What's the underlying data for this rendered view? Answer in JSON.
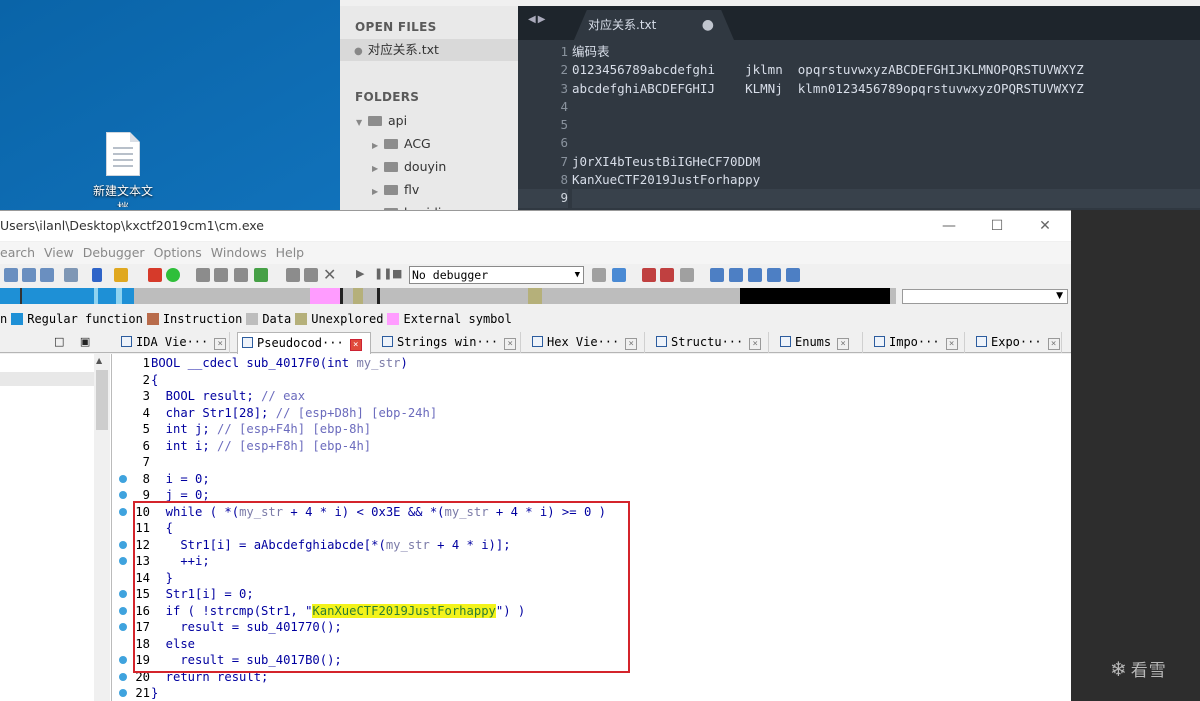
{
  "desktop": {
    "icon_label": "新建文本文",
    "icon_label_line2": "档"
  },
  "sublime": {
    "open_files_header": "OPEN FILES",
    "open_file": "对应关系.txt",
    "folders_header": "FOLDERS",
    "folders": [
      {
        "name": "api",
        "expanded": true,
        "level": 0
      },
      {
        "name": "ACG",
        "expanded": false,
        "level": 1
      },
      {
        "name": "douyin",
        "expanded": false,
        "level": 1
      },
      {
        "name": "flv",
        "expanded": false,
        "level": 1
      },
      {
        "name": "kuaidi",
        "expanded": false,
        "level": 1
      }
    ],
    "tab_title": "对应关系.txt",
    "tab_modified": "●",
    "lines": [
      {
        "n": "1",
        "text": "编码表"
      },
      {
        "n": "2",
        "text": "0123456789abcdefghi    jklmn  opqrstuvwxyzABCDEFGHIJKLMNOPQRSTUVWXYZ"
      },
      {
        "n": "3",
        "text": "abcdefghiABCDEFGHIJ    KLMNj  klmn0123456789opqrstuvwxyzOPQRSTUVWXYZ"
      },
      {
        "n": "4",
        "text": ""
      },
      {
        "n": "5",
        "text": ""
      },
      {
        "n": "6",
        "text": ""
      },
      {
        "n": "7",
        "text": "j0rXI4bTeustBiIGHeCF70DDM"
      },
      {
        "n": "8",
        "text": "KanXueCTF2019JustForhappy"
      },
      {
        "n": "9",
        "text": ""
      }
    ],
    "current_line": "9"
  },
  "ida": {
    "title": "Users\\ilanl\\Desktop\\kxctf2019cm1\\cm.exe",
    "window_controls": {
      "minimize": "—",
      "maximize": "☐",
      "close": "✕"
    },
    "menu": [
      "earch",
      "View",
      "Debugger",
      "Options",
      "Windows",
      "Help"
    ],
    "debugger_select": "No debugger",
    "legend": [
      {
        "label": "n",
        "color": ""
      },
      {
        "label": "Regular function",
        "color": "#1e90d6"
      },
      {
        "label": "Instruction",
        "color": "#b86b4b"
      },
      {
        "label": "Data",
        "color": "#bdbdbd"
      },
      {
        "label": "Unexplored",
        "color": "#b5b07a"
      },
      {
        "label": "External symbol",
        "color": "#ff9cff"
      }
    ],
    "left_panel_controls": "□ ▣ ×",
    "tabs": [
      {
        "label": "IDA Vie···",
        "active": false
      },
      {
        "label": "Pseudocod···",
        "active": true
      },
      {
        "label": "Strings win···",
        "active": false
      },
      {
        "label": "Hex Vie···",
        "active": false
      },
      {
        "label": "Structu···",
        "active": false
      },
      {
        "label": "Enums",
        "active": false
      },
      {
        "label": "Impo···",
        "active": false
      },
      {
        "label": "Expo···",
        "active": false
      }
    ],
    "pseudocode": [
      {
        "n": "1",
        "bp": false,
        "html": "BOOL __cdecl sub_4017F0(int my_str)"
      },
      {
        "n": "2",
        "bp": false,
        "html": "{"
      },
      {
        "n": "3",
        "bp": false,
        "html": "  BOOL result; // eax"
      },
      {
        "n": "4",
        "bp": false,
        "html": "  char Str1[28]; // [esp+D8h] [ebp-24h]"
      },
      {
        "n": "5",
        "bp": false,
        "html": "  int j; // [esp+F4h] [ebp-8h]"
      },
      {
        "n": "6",
        "bp": false,
        "html": "  int i; // [esp+F8h] [ebp-4h]"
      },
      {
        "n": "7",
        "bp": false,
        "html": ""
      },
      {
        "n": "8",
        "bp": true,
        "html": "  i = 0;"
      },
      {
        "n": "9",
        "bp": true,
        "html": "  j = 0;"
      },
      {
        "n": "10",
        "bp": true,
        "html": "  while ( *(my_str + 4 * i) < 0x3E && *(my_str + 4 * i) >= 0 )"
      },
      {
        "n": "11",
        "bp": false,
        "html": "  {"
      },
      {
        "n": "12",
        "bp": true,
        "html": "    Str1[i] = aAbcdefghiabcde[*(my_str + 4 * i)];"
      },
      {
        "n": "13",
        "bp": true,
        "html": "    ++i;"
      },
      {
        "n": "14",
        "bp": false,
        "html": "  }"
      },
      {
        "n": "15",
        "bp": true,
        "html": "  Str1[i] = 0;"
      },
      {
        "n": "16",
        "bp": true,
        "html": "  if ( !strcmp(Str1, \"KanXueCTF2019JustForhappy\") )"
      },
      {
        "n": "17",
        "bp": true,
        "html": "    result = sub_401770();"
      },
      {
        "n": "18",
        "bp": false,
        "html": "  else"
      },
      {
        "n": "19",
        "bp": true,
        "html": "    result = sub_4017B0();"
      },
      {
        "n": "20",
        "bp": true,
        "html": "  return result;"
      },
      {
        "n": "21",
        "bp": true,
        "html": "}"
      }
    ],
    "highlight_string": "KanXueCTF2019JustForhappy"
  },
  "watermark": "看雪"
}
